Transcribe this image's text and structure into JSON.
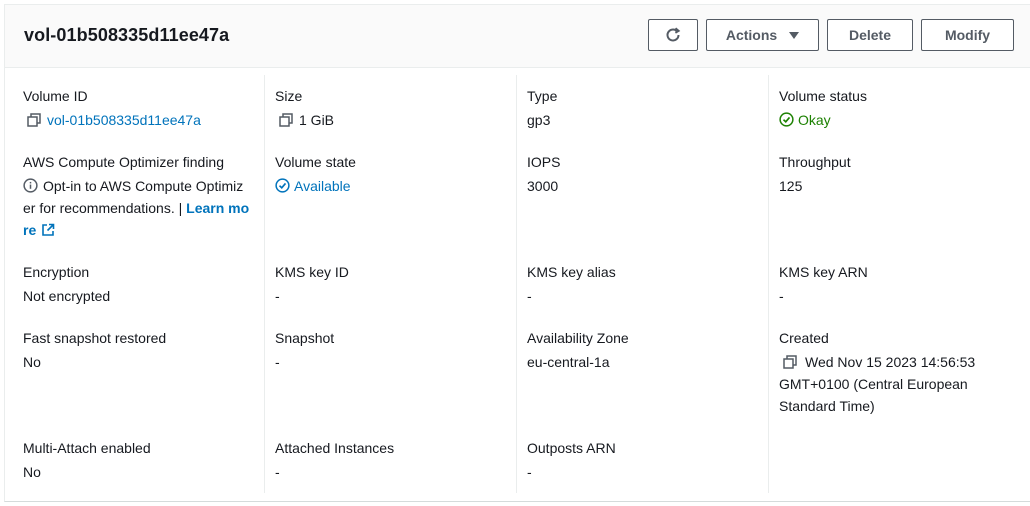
{
  "header": {
    "title": "vol-01b508335d11ee47a",
    "actions_label": "Actions",
    "delete_label": "Delete",
    "modify_label": "Modify"
  },
  "fields": {
    "volume_id": {
      "label": "Volume ID",
      "value": "vol-01b508335d11ee47a"
    },
    "size": {
      "label": "Size",
      "value": "1 GiB"
    },
    "type": {
      "label": "Type",
      "value": "gp3"
    },
    "volume_status": {
      "label": "Volume status",
      "value": "Okay"
    },
    "optimizer": {
      "label": "AWS Compute Optimizer finding",
      "line1": "Opt-in to AWS Compute Optimiz",
      "line2_text": "er for recommendations. | ",
      "line2_link": "Learn mo",
      "line3_link": "re"
    },
    "volume_state": {
      "label": "Volume state",
      "value": "Available"
    },
    "iops": {
      "label": "IOPS",
      "value": "3000"
    },
    "throughput": {
      "label": "Throughput",
      "value": "125"
    },
    "encryption": {
      "label": "Encryption",
      "value": "Not encrypted"
    },
    "kms_key_id": {
      "label": "KMS key ID",
      "value": "-"
    },
    "kms_key_alias": {
      "label": "KMS key alias",
      "value": "-"
    },
    "kms_key_arn": {
      "label": "KMS key ARN",
      "value": "-"
    },
    "fast_snapshot": {
      "label": "Fast snapshot restored",
      "value": "No"
    },
    "snapshot": {
      "label": "Snapshot",
      "value": "-"
    },
    "availability_zone": {
      "label": "Availability Zone",
      "value": "eu-central-1a"
    },
    "created": {
      "label": "Created",
      "line1": "Wed Nov 15 2023 14:56:53",
      "line2": "GMT+0100 (Central European",
      "line3": "Standard Time)"
    },
    "multi_attach": {
      "label": "Multi-Attach enabled",
      "value": "No"
    },
    "attached_instances": {
      "label": "Attached Instances",
      "value": "-"
    },
    "outposts_arn": {
      "label": "Outposts ARN",
      "value": "-"
    }
  },
  "colors": {
    "link": "#0073bb",
    "success": "#1d8102",
    "text": "#16191f",
    "button_border": "#545b64"
  },
  "icons": [
    "refresh-icon",
    "copy-icon",
    "status-ok-icon",
    "status-info-icon",
    "info-icon",
    "external-link-icon",
    "caret-down-icon"
  ]
}
